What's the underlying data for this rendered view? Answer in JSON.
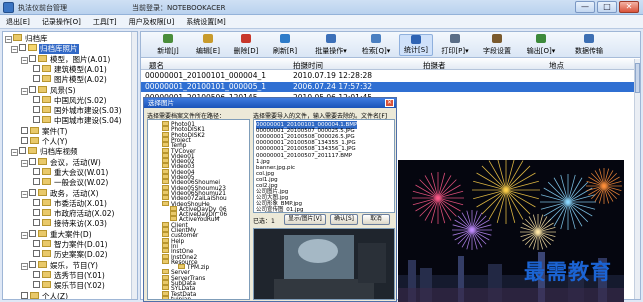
{
  "window": {
    "title": "执法仪前台管理",
    "user_label": "当前登录：NOTEBOOKACER",
    "controls": [
      "—",
      "□",
      "✕"
    ]
  },
  "menu": [
    "退出[E]",
    "记录操作[O]",
    "工具[T]",
    "用户及权限[U]",
    "系统设置[M]"
  ],
  "tree": {
    "items": [
      {
        "label": "归档库",
        "level": 0,
        "expanded": true
      },
      {
        "label": "归档库照片",
        "level": 1,
        "expanded": true,
        "selected": true
      },
      {
        "label": "模型，图片(A.01)",
        "level": 2,
        "expanded": true
      },
      {
        "label": "建筑模型(A.01)",
        "level": 3
      },
      {
        "label": "图片模型(A.02)",
        "level": 3
      },
      {
        "label": "风景(S)",
        "level": 2,
        "expanded": true
      },
      {
        "label": "中国风光(S.02)",
        "level": 3
      },
      {
        "label": "国外城市建设(S.03)",
        "level": 3
      },
      {
        "label": "中国城市建设(S.04)",
        "level": 3
      },
      {
        "label": "案件(T)",
        "level": 2
      },
      {
        "label": "个人(Y)",
        "level": 2
      },
      {
        "label": "归档库视频",
        "level": 1,
        "expanded": true
      },
      {
        "label": "会议，活动(W)",
        "level": 2,
        "expanded": true
      },
      {
        "label": "重大会议(W.01)",
        "level": 3
      },
      {
        "label": "一般会议(W.02)",
        "level": 3
      },
      {
        "label": "政务，活动(X)",
        "level": 2,
        "expanded": true
      },
      {
        "label": "市委活动(X.01)",
        "level": 3
      },
      {
        "label": "市政府活动(X.02)",
        "level": 3
      },
      {
        "label": "接待来访(X.03)",
        "level": 3
      },
      {
        "label": "重大案件(D)",
        "level": 2,
        "expanded": true
      },
      {
        "label": "智力案件(D.01)",
        "level": 3
      },
      {
        "label": "历史案案(D.02)",
        "level": 3
      },
      {
        "label": "娱乐，节目(Y)",
        "level": 2,
        "expanded": true
      },
      {
        "label": "选秀节目(Y.01)",
        "level": 3
      },
      {
        "label": "娱乐节目(Y.02)",
        "level": 3
      },
      {
        "label": "个人(Z)",
        "level": 2
      }
    ]
  },
  "toolbar": {
    "buttons": [
      {
        "label": "新增[J]",
        "icon": "new-icon",
        "color": "#4a8d3a"
      },
      {
        "label": "编辑[E]",
        "icon": "edit-icon",
        "color": "#c89b2c"
      },
      {
        "label": "删除[D]",
        "icon": "delete-icon",
        "color": "#c8372a"
      },
      {
        "label": "刷新[R]",
        "icon": "refresh-icon",
        "color": "#2d7bc9"
      },
      {
        "label": "批量操作",
        "icon": "batch-icon",
        "color": "#3b6fb8",
        "dropdown": "▾"
      },
      {
        "label": "检索[Q]",
        "icon": "search-icon",
        "color": "#4a7fc1",
        "dropdown": "▾"
      },
      {
        "label": "统计[S]",
        "icon": "stats-icon",
        "color": "#2e63b4"
      },
      {
        "label": "打印[P]",
        "icon": "print-icon",
        "color": "#5a6d86",
        "dropdown": "▾"
      },
      {
        "label": "字段设置",
        "icon": "fields-icon",
        "color": "#7a5a2d"
      },
      {
        "label": "输出[O]",
        "icon": "export-icon",
        "color": "#3d8a3b",
        "dropdown": "▾"
      },
      {
        "label": "数据传输",
        "icon": "transfer-icon",
        "color": "#3d6fb3"
      }
    ]
  },
  "grid": {
    "columns": [
      "题名",
      "拍摄时间",
      "拍摄者",
      "地点"
    ],
    "rows": [
      {
        "title": "00000001_20100101_000004_1",
        "time": "2010.07.19 12:28:28",
        "shooter": "",
        "place": "",
        "selected": false
      },
      {
        "title": "00000001_20100101_000005_1",
        "time": "2006.07.24 17:57:32",
        "shooter": "",
        "place": "",
        "selected": true
      },
      {
        "title": "00000001_20100506_120145",
        "time": "2010.05.06 12:01:45",
        "shooter": "",
        "place": "",
        "selected": false
      }
    ]
  },
  "dialog": {
    "title": "选择图片",
    "close": "✕",
    "hint_left": "选择需要档案文件所在路径：",
    "hint_right": "选择需要导入的文件，输入需要去除的。文件名[F]",
    "folders": [
      "Photo01",
      "PhotoDISK1",
      "PhotoDISK2",
      "Project",
      "Temp",
      "TVCover",
      "Video01",
      "Video02",
      "Video03",
      "Video04",
      "Video05",
      "Video06Shoumei",
      "Video05Shoumu23",
      "Video06Shoumu21",
      "Video07ZaiLaiShou",
      "VideoShouHe",
      "ActiveDayDy_06",
      "ActiveDayDir_06",
      "ActiveYouRuM",
      "Client",
      "ClientMy",
      "customer",
      "Help",
      "Ini",
      "InstOne",
      "InstOne2",
      "Resource",
      "TPM.zip",
      "Server",
      "ServerTrans",
      "SubData",
      "SYLData",
      "TestData",
      "tuipian"
    ],
    "files": [
      "00000001_20100101_000004.1.BMP",
      "00000001_20100507_000025.5.JPG",
      "00000001_20100508_000026.5.JPG",
      "00000001_20100508_134355_1.JPG",
      "00000001_20100508_134356_1.JPG",
      "00000001_20100507_201117.BMP",
      "1.jpg",
      "banner.jpg.pic",
      "col.jpg",
      "col1.jpg",
      "col2.jpg",
      "公司图片.jpg",
      "公司大图.jpg",
      "公司形象_BMP.jpg",
      "公司宣传图_01.jpg"
    ],
    "status": "已选：1",
    "btn_preview": "显示/图片[V]",
    "btn_ok": "确认[S]",
    "btn_cancel": "取消"
  },
  "watermark": "最需教育"
}
